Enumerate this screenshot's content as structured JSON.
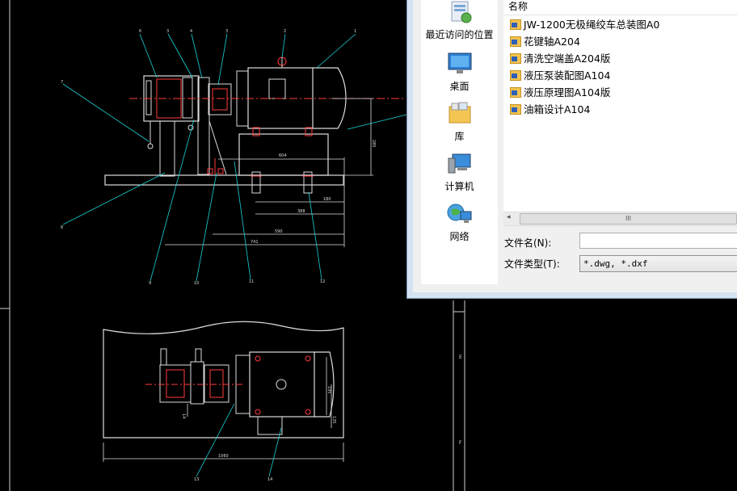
{
  "drawing": {
    "balloons": [
      "6",
      "3",
      "4",
      "3",
      "2",
      "1",
      "7",
      "8",
      "9",
      "10",
      "11",
      "12",
      "13",
      "14"
    ],
    "dims_top": [
      "604",
      "180",
      "388",
      "590",
      "741"
    ],
    "dims_plan": [
      "1060",
      "195",
      "135",
      "14"
    ],
    "dim_right": "285",
    "frame_letters": [
      "E",
      "F"
    ]
  },
  "dialog": {
    "places": [
      {
        "label": "最近访问的位置",
        "icon": "recent-places-icon"
      },
      {
        "label": "桌面",
        "icon": "desktop-icon"
      },
      {
        "label": "库",
        "icon": "library-icon"
      },
      {
        "label": "计算机",
        "icon": "computer-icon"
      },
      {
        "label": "网络",
        "icon": "network-icon"
      }
    ],
    "column_header": "名称",
    "files": [
      "JW-1200无极绳绞车总装图A0",
      "花键轴A204",
      "清洗空端盖A204版",
      "液压泵装配图A104",
      "液压原理图A104版",
      "油箱设计A104"
    ],
    "scroll_left": "◂",
    "scroll_grip": "III",
    "filename_label": "文件名(N):",
    "filename_value": "",
    "filetype_label": "文件类型(T):",
    "filetype_value": "*.dwg, *.dxf"
  }
}
